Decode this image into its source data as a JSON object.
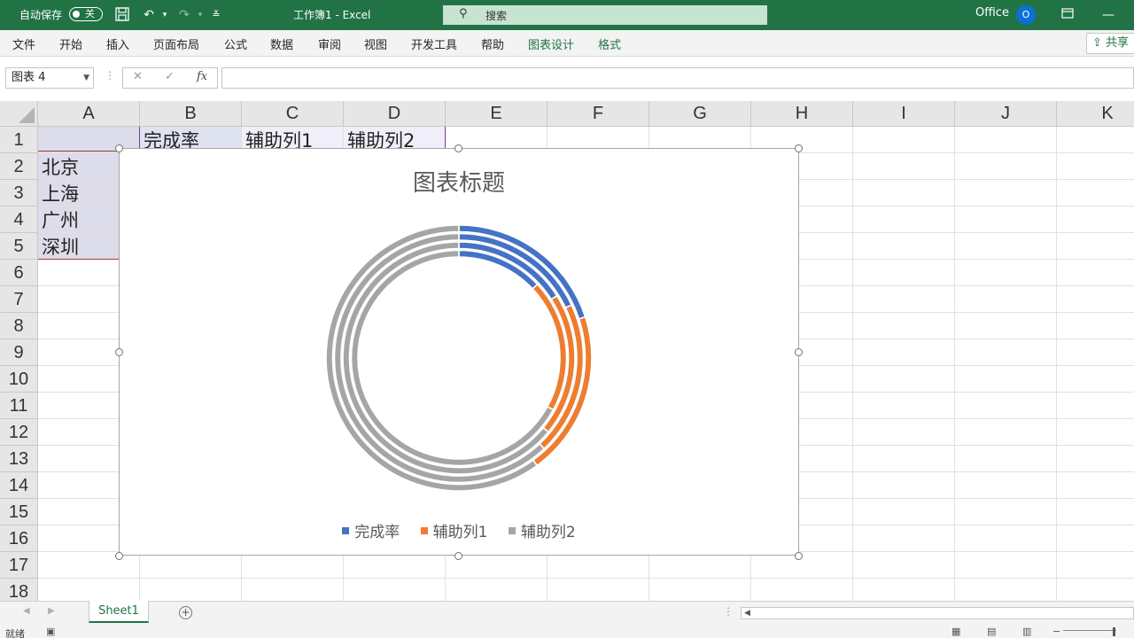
{
  "titlebar": {
    "autosave_label": "自动保存",
    "autosave_state": "关",
    "doc_title": "工作簿1  -  Excel",
    "search_placeholder": "搜索",
    "account_name": "Office",
    "avatar_letter": "O"
  },
  "ribbon": {
    "tabs": [
      "文件",
      "开始",
      "插入",
      "页面布局",
      "公式",
      "数据",
      "审阅",
      "视图",
      "开发工具",
      "帮助",
      "图表设计",
      "格式"
    ],
    "share_label": "共享"
  },
  "formula_bar": {
    "name_box": "图表 4",
    "cancel": "✕",
    "enter": "✓",
    "fx": "fx",
    "formula": ""
  },
  "grid": {
    "columns": [
      "A",
      "B",
      "C",
      "D",
      "E",
      "F",
      "G",
      "H",
      "I",
      "J",
      "K"
    ],
    "rows": [
      "1",
      "2",
      "3",
      "4",
      "5",
      "6",
      "7",
      "8",
      "9",
      "10",
      "11",
      "12",
      "13",
      "14",
      "15",
      "16",
      "17",
      "18"
    ],
    "cells": {
      "B1": "完成率",
      "C1": "辅助列1",
      "D1": "辅助列2",
      "A2": "北京",
      "A3": "上海",
      "A4": "广州",
      "A5": "深圳"
    }
  },
  "chart_data": {
    "type": "donut",
    "title": "图表标题",
    "rings": [
      "北京",
      "上海",
      "广州",
      "深圳"
    ],
    "series": [
      {
        "name": "完成率",
        "color": "#4472C4",
        "values": [
          0.2,
          0.18,
          0.16,
          0.13
        ]
      },
      {
        "name": "辅助列1",
        "color": "#ED7D31",
        "values": [
          0.2,
          0.2,
          0.2,
          0.2
        ]
      },
      {
        "name": "辅助列2",
        "color": "#A5A5A5",
        "values": [
          0.6,
          0.62,
          0.64,
          0.67
        ]
      }
    ],
    "legend_position": "bottom"
  },
  "sheets": {
    "tabs": [
      "Sheet1"
    ],
    "active": "Sheet1",
    "add": "+"
  },
  "statusbar": {
    "text": "就绪"
  }
}
